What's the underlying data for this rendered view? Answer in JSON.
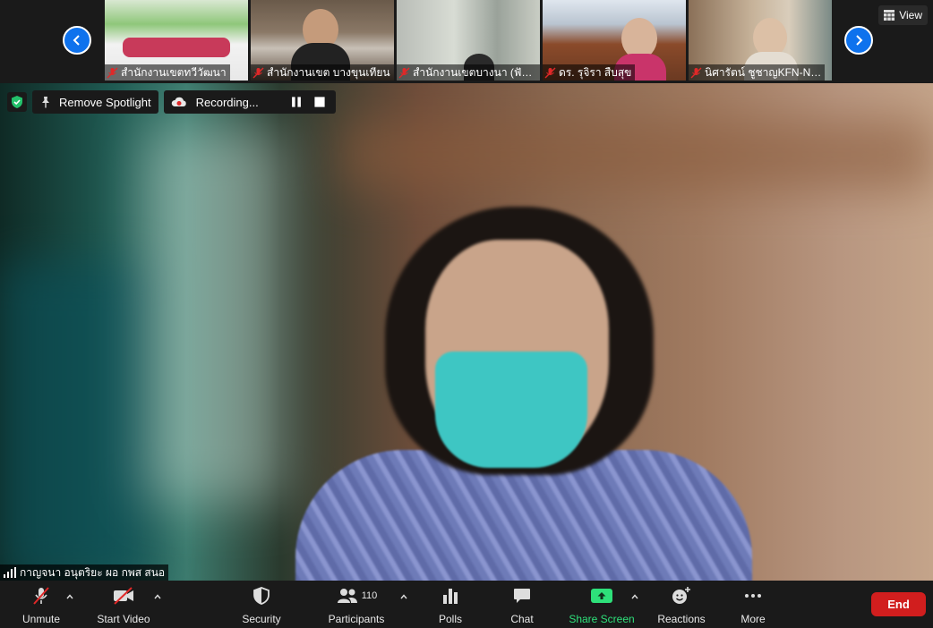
{
  "top_strip": {
    "view_label": "View",
    "thumbnails": [
      {
        "name": "สำนักงานเขตทวีวัฒนา",
        "muted": true
      },
      {
        "name": "สำนักงานเขต บางขุนเทียน",
        "muted": true
      },
      {
        "name": "สำนักงานเขตบางนา (ฟัช…",
        "muted": true
      },
      {
        "name": "ดร. รุจิรา สืบสุข",
        "muted": true
      },
      {
        "name": "นิศารัตน์ ชูชาญKFN-N…",
        "muted": true
      }
    ]
  },
  "spotlight": {
    "remove_spotlight_label": "Remove Spotlight",
    "recording_label": "Recording..."
  },
  "speaker": {
    "name": "กาญจนา อนุตริยะ ผอ กพส สนอ"
  },
  "toolbar": {
    "unmute_label": "Unmute",
    "start_video_label": "Start Video",
    "security_label": "Security",
    "participants_label": "Participants",
    "participants_count": "110",
    "polls_label": "Polls",
    "chat_label": "Chat",
    "share_screen_label": "Share Screen",
    "reactions_label": "Reactions",
    "more_label": "More",
    "end_label": "End"
  },
  "colors": {
    "accent": "#0e72ed",
    "share_green": "#2ee07a",
    "end_red": "#d11e1e",
    "muted_red": "#e02828"
  }
}
